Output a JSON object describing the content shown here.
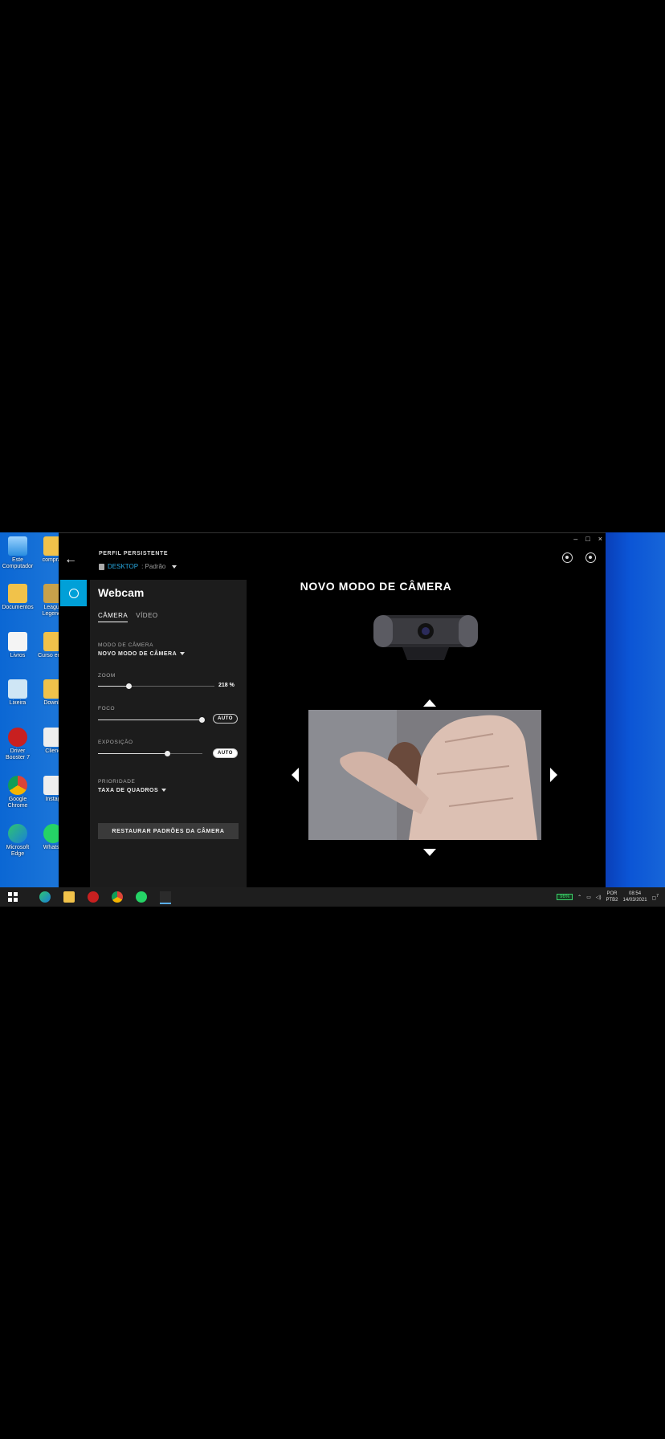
{
  "desktop": {
    "icons": [
      {
        "label": "Este Computador",
        "name": "este-computador"
      },
      {
        "label": "compras",
        "name": "compras"
      },
      {
        "label": "Documentos",
        "name": "documentos"
      },
      {
        "label": "League Legends",
        "name": "league-legends"
      },
      {
        "label": "Livros",
        "name": "livros"
      },
      {
        "label": "Curso emoc",
        "name": "curso-emoc"
      },
      {
        "label": "Lixeira",
        "name": "lixeira"
      },
      {
        "label": "Downlo",
        "name": "downloads"
      },
      {
        "label": "Driver Booster 7",
        "name": "driver-booster"
      },
      {
        "label": "Clienc",
        "name": "clienc"
      },
      {
        "label": "Google Chrome",
        "name": "google-chrome"
      },
      {
        "label": "Instag",
        "name": "instagram"
      },
      {
        "label": "Microsoft Edge",
        "name": "microsoft-edge"
      },
      {
        "label": "WhatsA",
        "name": "whatsapp"
      }
    ]
  },
  "window": {
    "controls": {
      "minimize": "–",
      "maximize": "□",
      "close": "×"
    }
  },
  "header": {
    "back_icon": "←",
    "profile_label": "PERFIL PERSISTENTE",
    "profile_value": "DESKTOP",
    "profile_sub": ": Padrão"
  },
  "panel": {
    "title": "Webcam",
    "tabs": [
      {
        "label": "CÂMERA",
        "active": true
      },
      {
        "label": "VÍDEO",
        "active": false
      }
    ],
    "camera_mode": {
      "label": "MODO DE CÂMERA",
      "value": "NOVO MODO DE CÂMERA"
    },
    "zoom": {
      "label": "ZOOM",
      "value_text": "218 %",
      "position": 0.26
    },
    "focus": {
      "label": "FOCO",
      "auto_label": "AUTO",
      "auto_on": false,
      "position": 0.99
    },
    "exposure": {
      "label": "EXPOSIÇÃO",
      "auto_label": "AUTO",
      "auto_on": true,
      "position": 0.66
    },
    "priority": {
      "label": "PRIORIDADE",
      "value": "TAXA DE QUADROS"
    },
    "restore_label": "RESTAURAR PADRÕES DA CÂMERA"
  },
  "main": {
    "title": "NOVO MODO DE CÂMERA"
  },
  "taskbar": {
    "battery": "96%",
    "lang_top": "POR",
    "lang_bottom": "PTB2",
    "time": "08:54",
    "date": "14/03/2021",
    "notification_count": "7"
  },
  "colors": {
    "accent": "#00a0d8",
    "panel_bg": "#1c1c1c",
    "desktop_blue": "#0b67d4"
  }
}
